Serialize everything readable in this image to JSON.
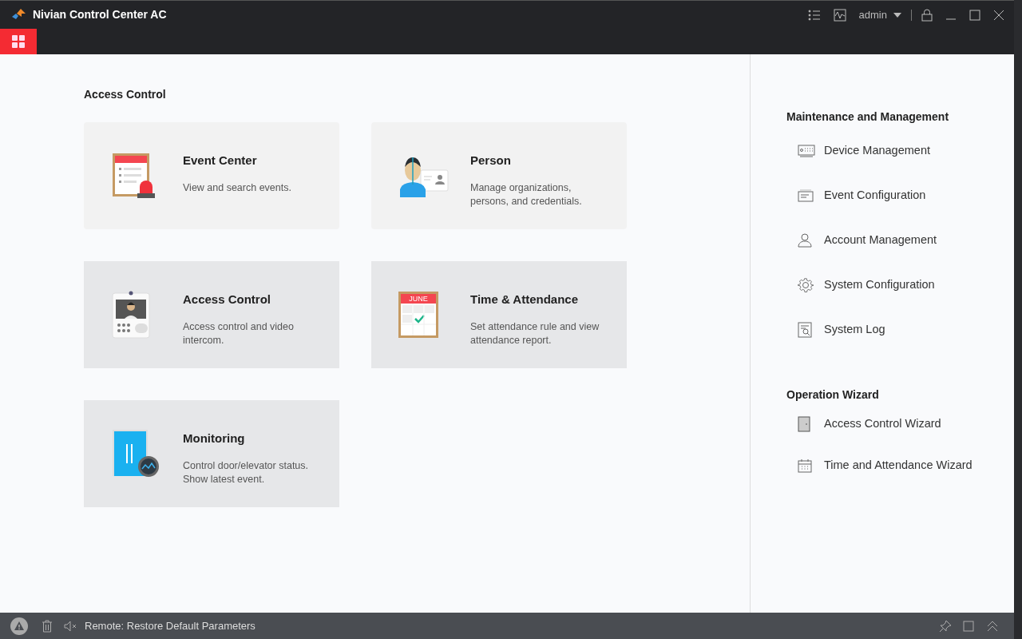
{
  "window": {
    "title": "Nivian Control Center AC",
    "user": "admin"
  },
  "section": {
    "title": "Access Control"
  },
  "cards": [
    {
      "title": "Event Center",
      "description": "View and search events.",
      "highlighted": false
    },
    {
      "title": "Person",
      "description": "Manage organizations, persons, and credentials.",
      "highlighted": false
    },
    {
      "title": "Access Control",
      "description": "Access control and video intercom.",
      "highlighted": true
    },
    {
      "title": "Time & Attendance",
      "description": "Set attendance rule and view attendance report.",
      "highlighted": true,
      "icon_label": "JUNE"
    },
    {
      "title": "Monitoring",
      "description": "Control door/elevator status. Show latest event.",
      "highlighted": true
    }
  ],
  "side_groups": [
    {
      "title": "Maintenance and Management",
      "items": [
        {
          "label": "Device Management"
        },
        {
          "label": "Event Configuration"
        },
        {
          "label": "Account Management"
        },
        {
          "label": "System Configuration"
        },
        {
          "label": "System Log"
        }
      ]
    },
    {
      "title": "Operation Wizard",
      "items": [
        {
          "label": "Access Control Wizard"
        },
        {
          "label": "Time and Attendance Wizard"
        }
      ]
    }
  ],
  "status_bar": {
    "message": "Remote: Restore Default Parameters"
  }
}
